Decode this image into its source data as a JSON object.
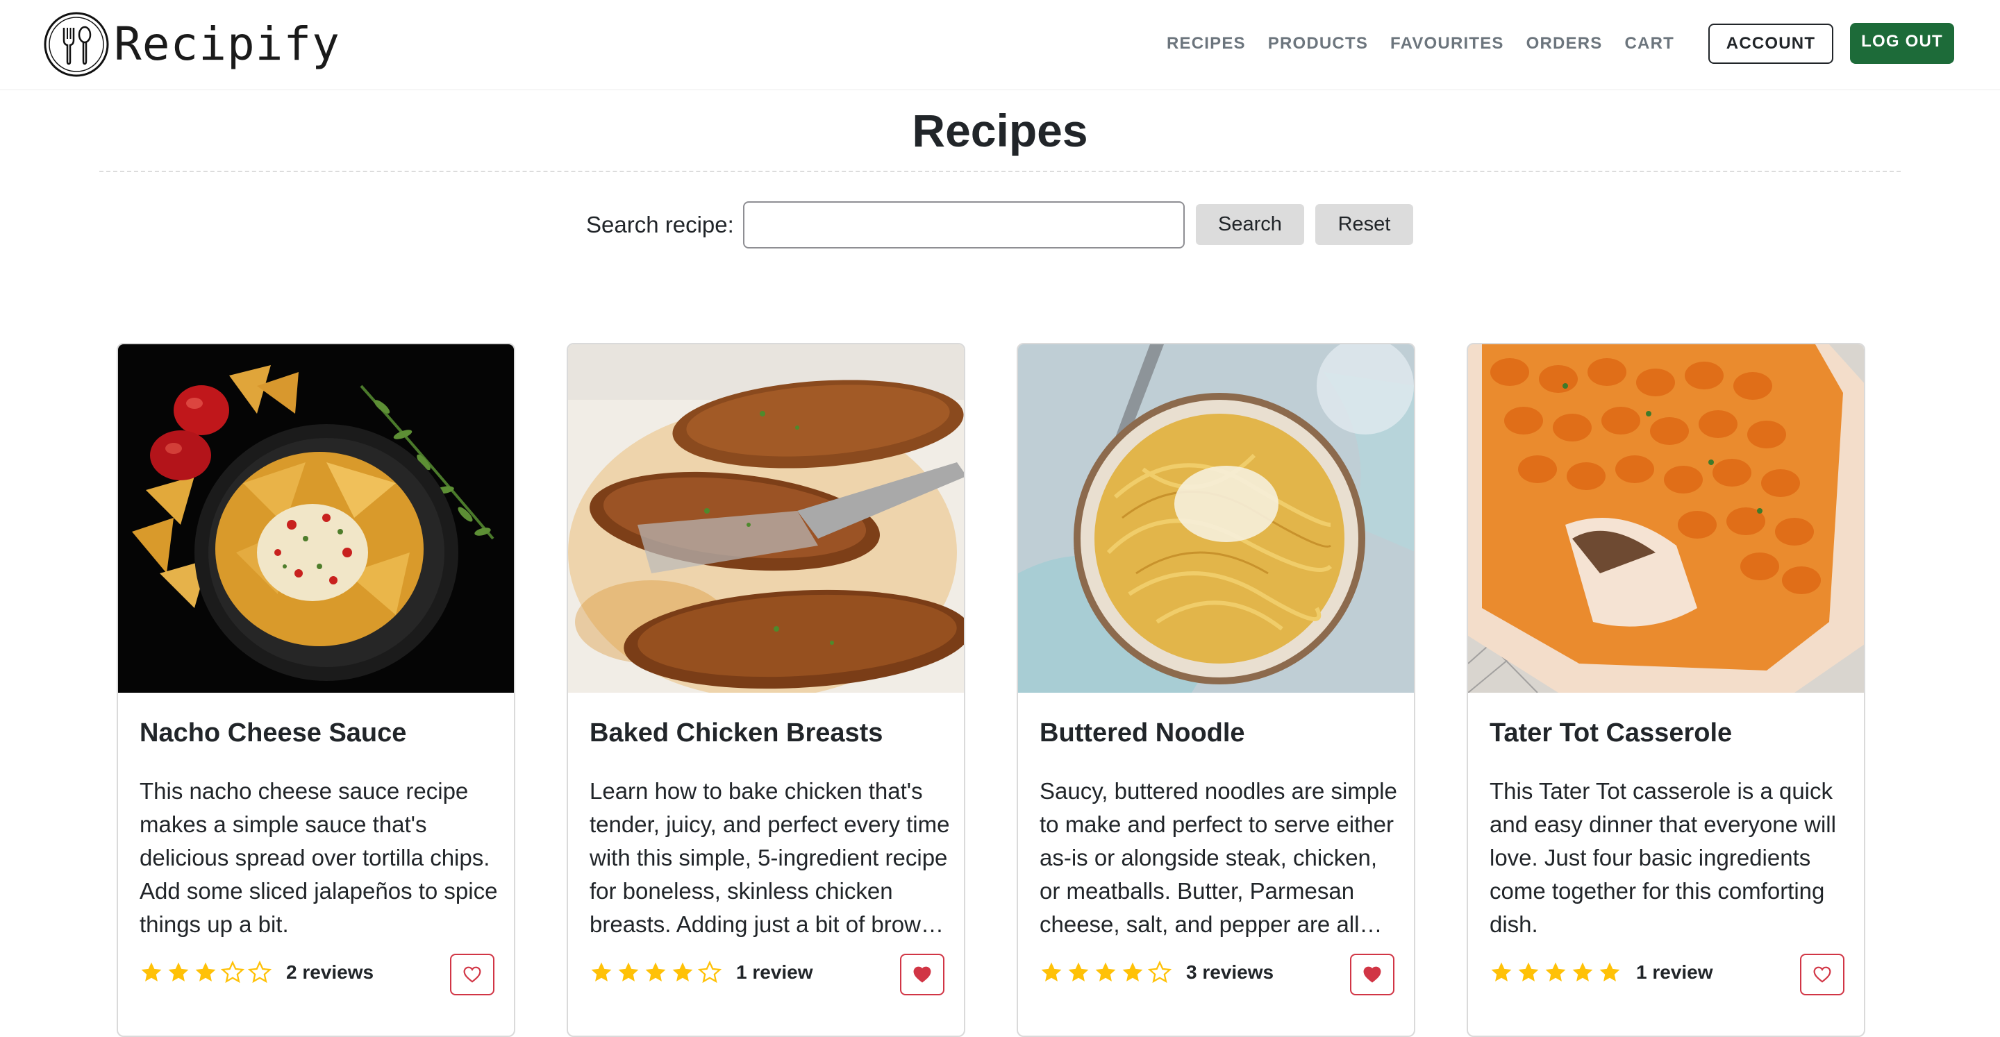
{
  "brand": {
    "name": "Recipify",
    "logo_icon": "cutlery-logo-icon"
  },
  "nav": {
    "links": [
      "RECIPES",
      "PRODUCTS",
      "FAVOURITES",
      "ORDERS",
      "CART"
    ],
    "account_label": "ACCOUNT",
    "logout_label": "LOG OUT"
  },
  "page": {
    "title": "Recipes"
  },
  "search": {
    "label": "Search recipe:",
    "value": "",
    "placeholder": "",
    "search_label": "Search",
    "reset_label": "Reset"
  },
  "colors": {
    "star": "#ffc107",
    "favourite": "#d13545",
    "logout_bg": "#1d6b39"
  },
  "recipes": [
    {
      "title": "Nacho Cheese Sauce",
      "description": "This nacho cheese sauce recipe makes a simple sauce that's delicious spread over tortilla chips. Add some sliced jalapeños to spice things up a bit.",
      "rating": 3,
      "reviews": "2 reviews",
      "favourited": false,
      "image": "nachos-photo"
    },
    {
      "title": "Baked Chicken Breasts",
      "description": "Learn how to bake chicken that's tender, juicy, and perfect every time with this simple, 5-ingredient recipe for boneless, skinless chicken breasts. Adding just a bit of brown sugar to the spice rub gives it a wonderful color.",
      "rating": 4,
      "reviews": "1 review",
      "favourited": true,
      "image": "baked-chicken-photo"
    },
    {
      "title": "Buttered Noodle",
      "description": "Saucy, buttered noodles are simple to make and perfect to serve either as-is or alongside steak, chicken, or meatballs. Butter, Parmesan cheese, salt, and pepper are all you need.",
      "rating": 4,
      "reviews": "3 reviews",
      "favourited": true,
      "image": "buttered-noodles-photo"
    },
    {
      "title": "Tater Tot Casserole",
      "description": "This Tater Tot casserole is a quick and easy dinner that everyone will love. Just four basic ingredients come together for this comforting dish.",
      "rating": 5,
      "reviews": "1 review",
      "favourited": false,
      "image": "tater-tot-casserole-photo"
    }
  ]
}
